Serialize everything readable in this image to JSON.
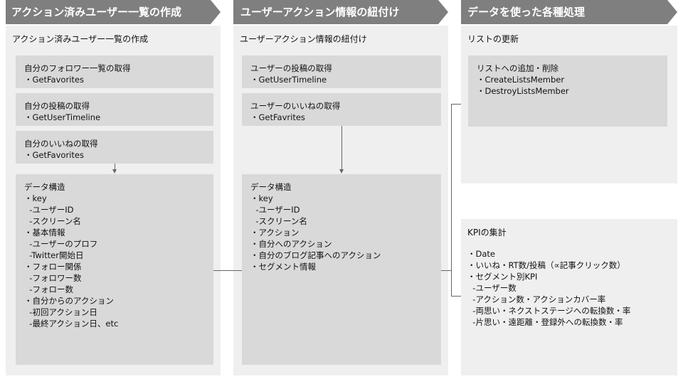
{
  "colors": {
    "header": "#7f7f7f",
    "column": "#efefef",
    "box": "#d9d9d9",
    "connector": "#666666"
  },
  "header": {
    "col1": "アクション済みユーザー一覧の作成",
    "col2": "ユーザーアクション情報の紐付け",
    "col3": "データを使った各種処理"
  },
  "col1": {
    "section_title": "アクション済みユーザー一覧の作成",
    "box1": {
      "title": "自分のフォロワー一覧の取得",
      "lines": [
        "・GetFavorites"
      ]
    },
    "box2": {
      "title": "自分の投稿の取得",
      "lines": [
        "・GetUserTimeline"
      ]
    },
    "box3": {
      "title": "自分のいいねの取得",
      "lines": [
        "・GetFavorites"
      ]
    },
    "data": {
      "title": "データ構造",
      "lines": [
        "・key",
        "  -ユーザーID",
        "  -スクリーン名",
        "",
        "・基本情報",
        "  -ユーザーのプロフ",
        "  -Twitter開始日",
        "",
        "・フォロー関係",
        "  -フォロワー数",
        "  -フォロー数",
        "",
        "・自分からのアクション",
        "  -初回アクション日",
        "  -最終アクション日、etc"
      ]
    }
  },
  "col2": {
    "section_title": "ユーザーアクション情報の紐付け",
    "box1": {
      "title": "ユーザーの投稿の取得",
      "lines": [
        "・GetUserTimeline"
      ]
    },
    "box2": {
      "title": "ユーザーのいいねの取得",
      "lines": [
        "・GetFavrites"
      ]
    },
    "data": {
      "title": "データ構造",
      "lines": [
        "・key",
        "  -ユーザーID",
        "  -スクリーン名",
        "",
        "・アクション",
        "・自分へのアクション",
        "・自分のブログ記事へのアクション",
        "・セグメント情報"
      ]
    }
  },
  "col3": {
    "list_panel": {
      "section_title": "リストの更新",
      "box": {
        "title": "リストへの追加・削除",
        "lines": [
          "・CreateListsMember",
          "・DestroyListsMember"
        ]
      }
    },
    "kpi_panel": {
      "section_title": "KPIの集計",
      "lines": [
        "・Date",
        "・いいね・RT数/投稿（∝記事クリック数）",
        "・セグメント別KPI",
        "  -ユーザー数",
        "  -アクション数・アクションカバー率",
        "  -両思い・ネクストステージへの転換数・率",
        "  -片思い・遠距離・登録外への転換数・率"
      ]
    }
  }
}
